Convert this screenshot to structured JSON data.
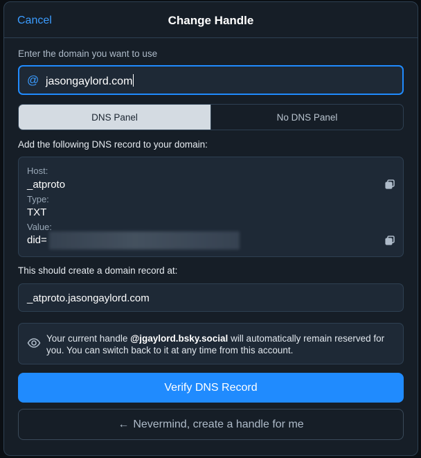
{
  "header": {
    "cancel_label": "Cancel",
    "title": "Change Handle"
  },
  "domain": {
    "label": "Enter the domain you want to use",
    "prefix_icon": "@",
    "value": "jasongaylord.com"
  },
  "tabs": [
    {
      "label": "DNS Panel",
      "selected": true
    },
    {
      "label": "No DNS Panel",
      "selected": false
    }
  ],
  "dns_instructions": "Add the following DNS record to your domain:",
  "dns_record": {
    "host_label": "Host:",
    "host_value": "_atproto",
    "type_label": "Type:",
    "type_value": "TXT",
    "value_label": "Value:",
    "value_prefix": "did="
  },
  "record_location": {
    "label": "This should create a domain record at:",
    "value": "_atproto.jasongaylord.com"
  },
  "notice": {
    "icon": "eye-icon",
    "text_before": "Your current handle ",
    "handle": "@jgaylord.bsky.social",
    "text_after": " will automatically remain reserved for you. You can switch back to it at any time from this account."
  },
  "buttons": {
    "verify_label": "Verify DNS Record",
    "nevermind_arrow": "←",
    "nevermind_label": "Nevermind, create a handle for me"
  },
  "colors": {
    "accent": "#208bfe",
    "background": "#161e27",
    "card": "#1e2936",
    "border": "#2e4052"
  }
}
